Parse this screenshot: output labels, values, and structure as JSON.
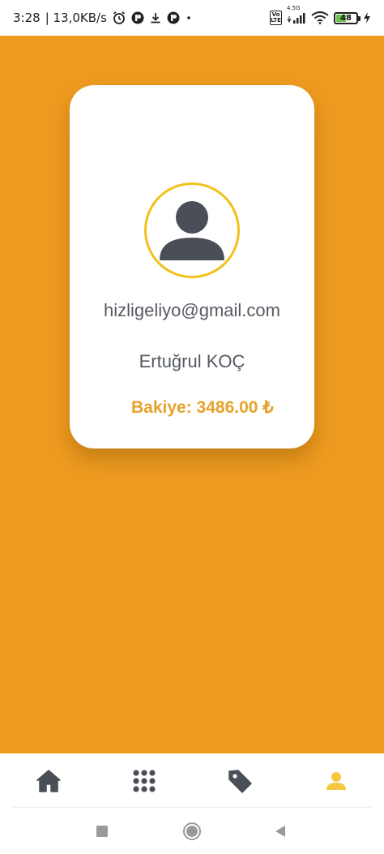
{
  "status_bar": {
    "time": "3:28",
    "speed": "| 13,0KB/s",
    "icons_left": [
      "alarm-icon",
      "app-notification-icon",
      "download-icon",
      "app-notification-icon"
    ],
    "network_label": "4.5G",
    "battery_level": "48",
    "icons_right": [
      "volte-icon",
      "signal-icon",
      "wifi-icon",
      "battery-icon",
      "charging-icon"
    ]
  },
  "colors": {
    "background": "#ee9c20",
    "card": "#ffffff",
    "avatar_ring": "#f0c21a",
    "text_gray": "#555a62",
    "balance": "#e6a22a",
    "active_nav": "#f5c842",
    "inactive_nav": "#4a4e57"
  },
  "profile": {
    "email": "hizligeliyo@gmail.com",
    "name": "Ertuğrul KOÇ",
    "balance": "Bakiye: 3486.00 ₺"
  },
  "bottom_nav": {
    "items": [
      {
        "icon": "home-icon",
        "active": false
      },
      {
        "icon": "grid-icon",
        "active": false
      },
      {
        "icon": "tag-icon",
        "active": false
      },
      {
        "icon": "profile-icon",
        "active": true
      }
    ]
  },
  "system_nav": {
    "buttons": [
      "recents-button",
      "home-button",
      "back-button"
    ]
  }
}
